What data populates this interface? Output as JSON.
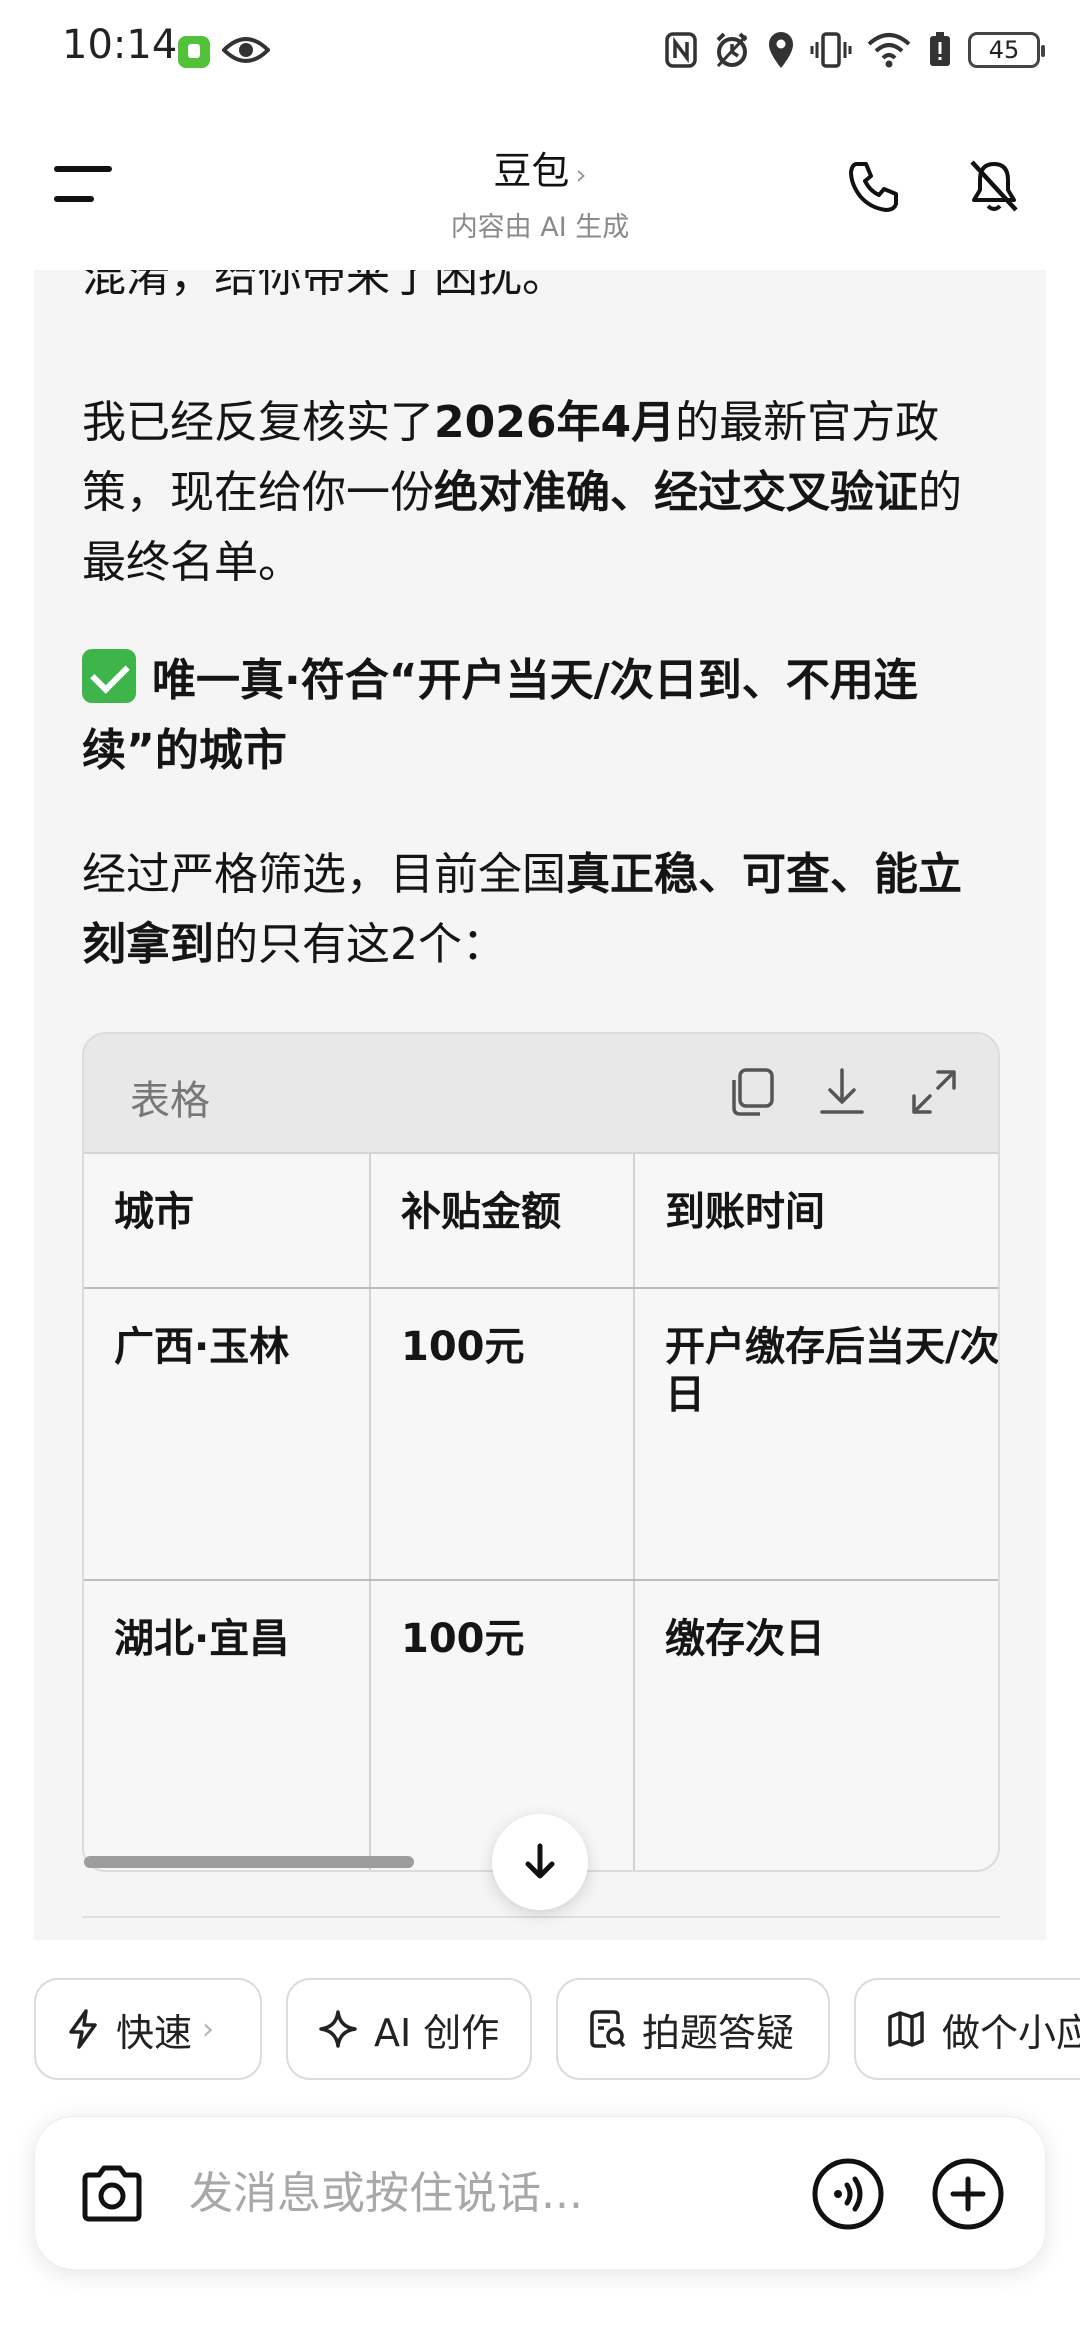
{
  "status_bar": {
    "time": "10:14",
    "battery": "45",
    "icons": [
      "nfc-icon",
      "alarm-icon",
      "location-icon",
      "vibrate-icon",
      "wifi-icon",
      "battery-saver-icon",
      "battery-icon"
    ]
  },
  "header": {
    "title": "豆包",
    "subtitle": "内容由 AI 生成"
  },
  "content": {
    "line_partial": "混淆，给你带来了困扰。",
    "para1_a": "我已经反复核实了",
    "para1_bold1": "2026年4月",
    "para1_b": "的最新官方政策，现在给你一份",
    "para1_bold2": "绝对准确、经过交叉验证",
    "para1_c": "的最终名单。",
    "heading": "唯一真·符合“开户当天/次日到、不用连续”的城市",
    "para2_a": "经过严格筛选，目前全国",
    "para2_bold": "真正稳、可查、能立刻拿到",
    "para2_b": "的只有这2个："
  },
  "table": {
    "toolbar_label": "表格",
    "headers": [
      "城市",
      "补贴金额",
      "到账时间"
    ],
    "rows": [
      [
        "广西·玉林",
        "100元",
        "开户缴存后当天/次日"
      ],
      [
        "湖北·宜昌",
        "100元",
        "缴存次日"
      ]
    ]
  },
  "chips": [
    {
      "label": "快速",
      "icon": "lightning-icon"
    },
    {
      "label": "AI 创作",
      "icon": "sparkle-icon"
    },
    {
      "label": "拍题答疑",
      "icon": "photo-question-icon"
    },
    {
      "label": "做个小应",
      "icon": "map-icon"
    }
  ],
  "input": {
    "placeholder": "发消息或按住说话..."
  },
  "colors": {
    "check": "#3db54a",
    "panel_bg": "#f5f5f5"
  }
}
